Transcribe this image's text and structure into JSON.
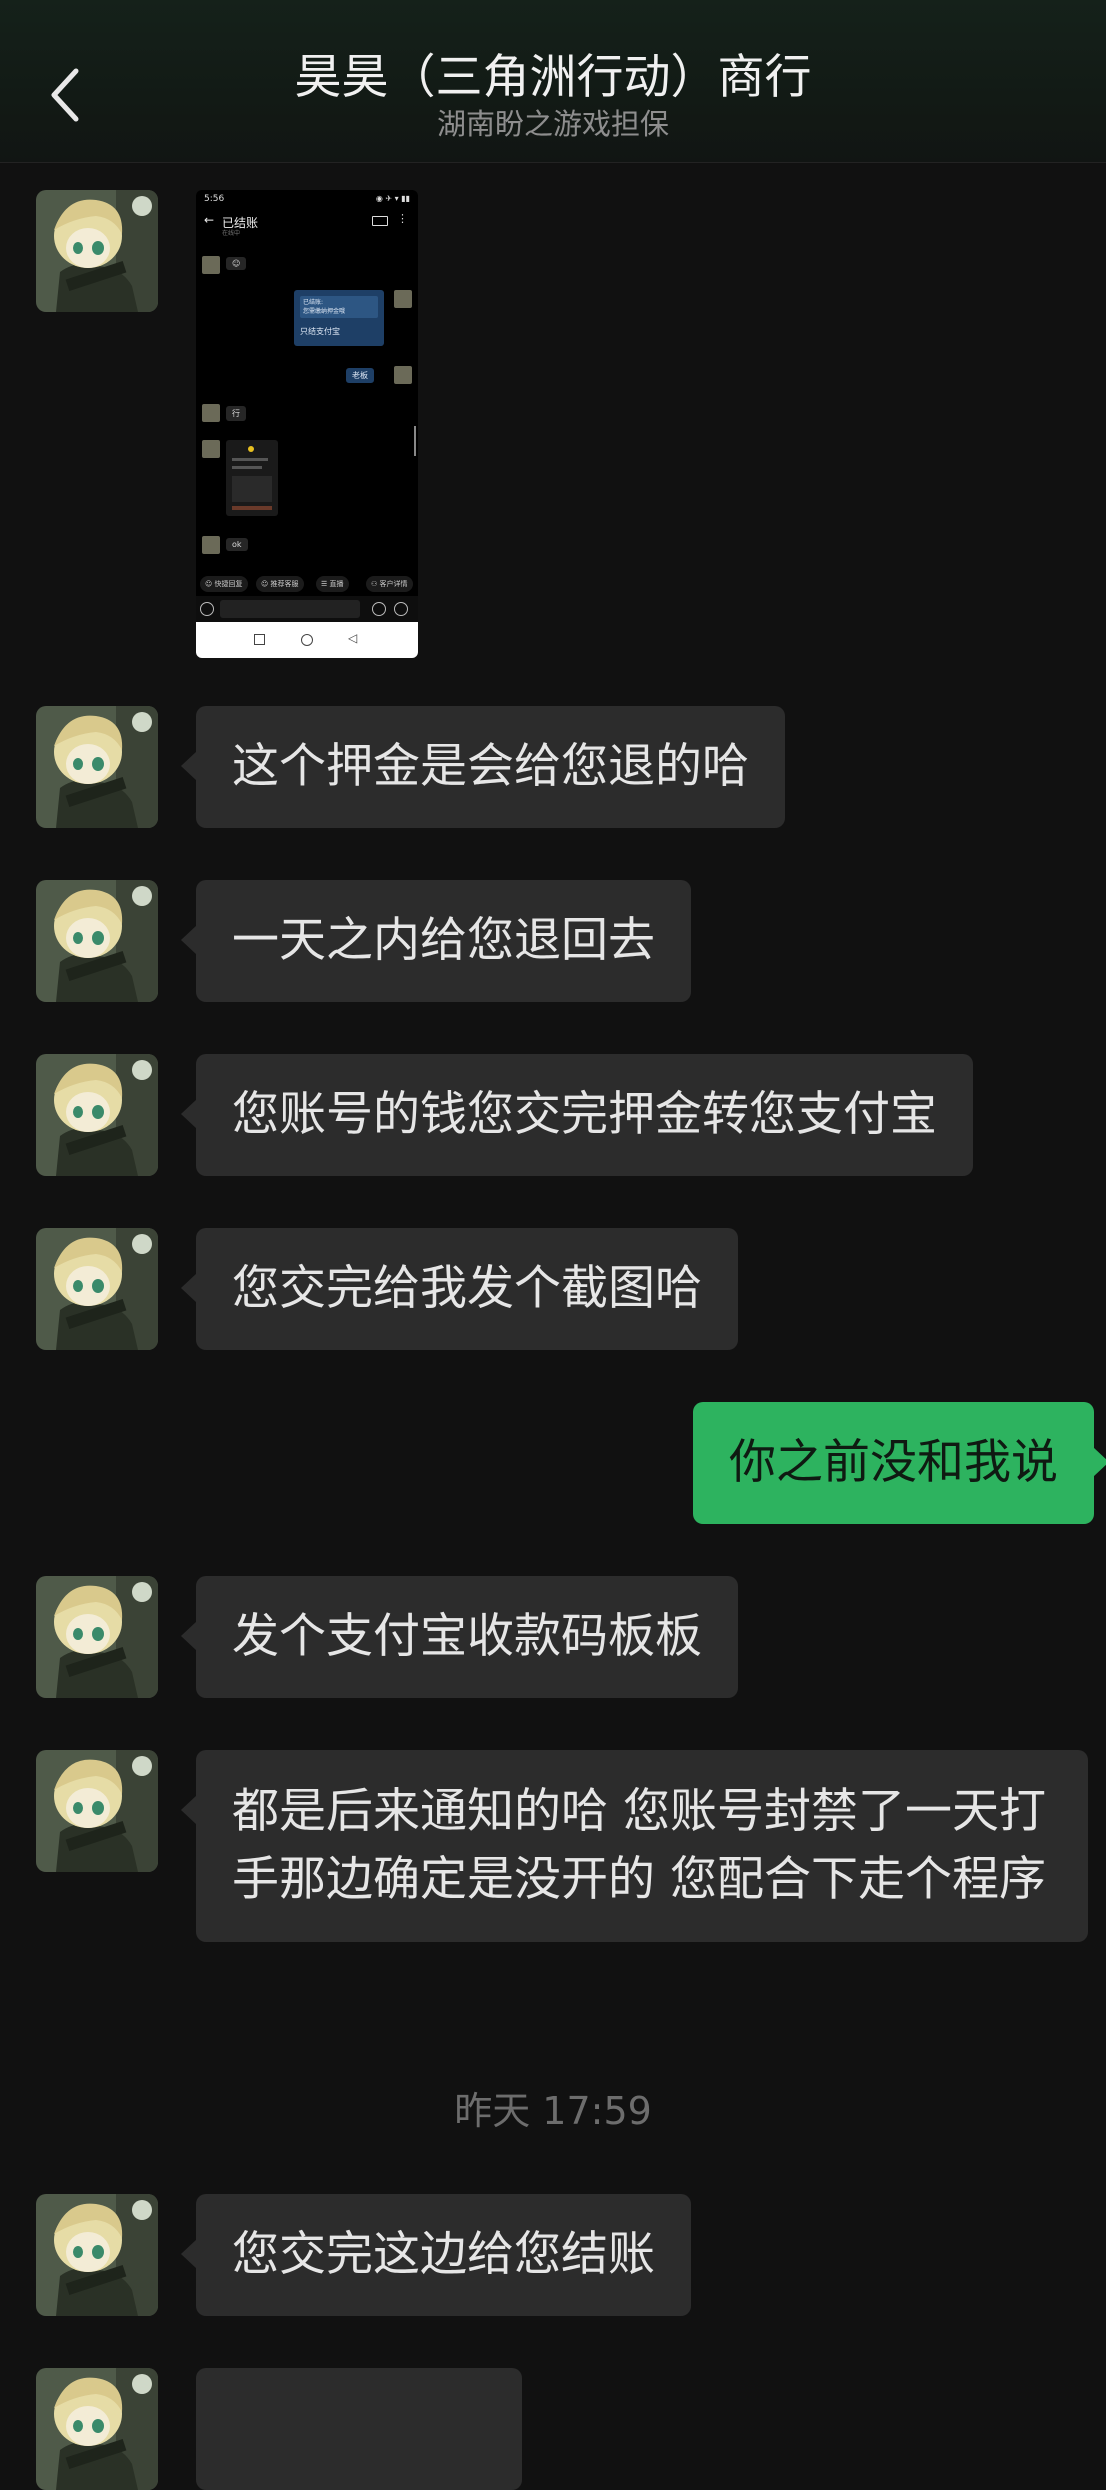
{
  "header": {
    "title": "昊昊（三角洲行动）商行",
    "subtitle": "湖南盼之游戏担保"
  },
  "screenshot_message": {
    "status_time": "5:56",
    "status_icons": "◉ ✈ ▾ ▮▮",
    "chat_title": "已结账",
    "chat_subtitle": "在线中",
    "emoji": "☺",
    "quote_line1": "已结账:",
    "quote_line2": "您需缴纳押金哦",
    "quote_reply": "只结支付宝",
    "boss_label": "老板",
    "reply_ok1": "行",
    "reply_ok2": "ok",
    "quick_actions": [
      "快捷回复",
      "推荐客服",
      "直播",
      "客户详情"
    ]
  },
  "messages": [
    {
      "side": "left",
      "text": "这个押金是会给您退的哈"
    },
    {
      "side": "left",
      "text": "一天之内给您退回去"
    },
    {
      "side": "left",
      "text": "您账号的钱您交完押金转您支付宝"
    },
    {
      "side": "left",
      "text": "您交完给我发个截图哈"
    },
    {
      "side": "right",
      "text": "你之前没和我说"
    },
    {
      "side": "left",
      "text": "发个支付宝收款码板板"
    },
    {
      "side": "left",
      "text": "都是后来通知的哈 您账号封禁了一天打手那边确定是没开的 您配合下走个程序"
    },
    {
      "side": "left",
      "text": "您交完这边给您结账"
    }
  ],
  "time_divider": "昨天 17:59",
  "colors": {
    "background": "#111111",
    "bubble_other": "#2c2c2c",
    "bubble_mine": "#2db35f",
    "header_text": "#f0f0f0",
    "subtitle_text": "#8e8e8e",
    "divider_text": "#6d6d6d"
  },
  "icons": {
    "back": "chevron-left-icon",
    "avatar": "anime-character-avatar"
  }
}
